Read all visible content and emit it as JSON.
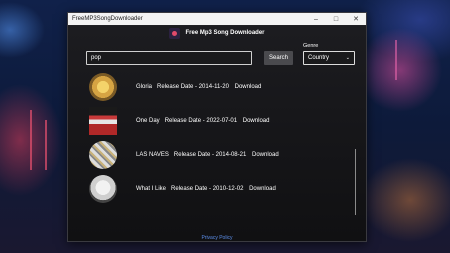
{
  "window": {
    "title": "FreeMP3SongDownloader",
    "minimize_icon": "minimize-icon",
    "maximize_icon": "maximize-icon",
    "close_icon": "close-icon"
  },
  "header": {
    "app_name": "Free Mp3 Song Downloader",
    "logo_icon": "music-app-logo"
  },
  "search": {
    "value": "pop",
    "button_label": "Search"
  },
  "genre": {
    "label": "Genre",
    "selected": "Country"
  },
  "songs": [
    {
      "title": "Gloria",
      "release_label": "Release Date - 2014-11-20",
      "download_label": "Download"
    },
    {
      "title": "One Day",
      "release_label": "Release Date - 2022-07-01",
      "download_label": "Download"
    },
    {
      "title": "LAS NAVES",
      "release_label": "Release Date - 2014-08-21",
      "download_label": "Download"
    },
    {
      "title": "What I Like",
      "release_label": "Release Date - 2010-12-02",
      "download_label": "Download"
    }
  ],
  "footer": {
    "privacy_label": "Privacy Policy"
  },
  "colors": {
    "accent": "#5b8de8",
    "window_bg": "#1c1c20",
    "titlebar": "#f3f3f3"
  }
}
